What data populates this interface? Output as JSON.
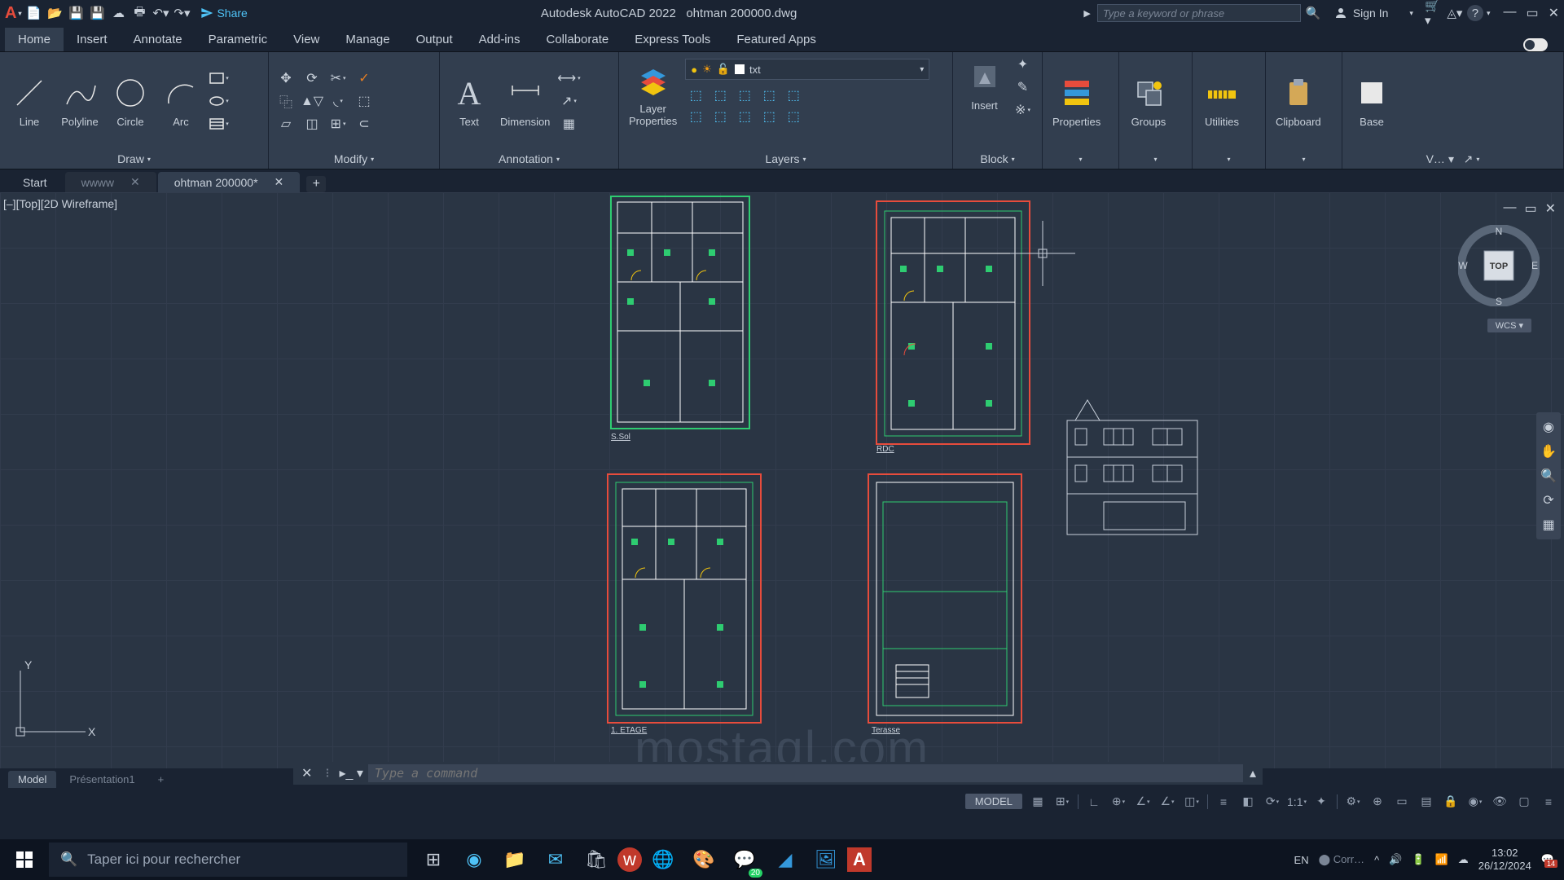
{
  "app": {
    "product": "Autodesk AutoCAD 2022",
    "filename": "ohtman 200000.dwg",
    "share_label": "Share",
    "search_placeholder": "Type a keyword or phrase",
    "signin_label": "Sign In"
  },
  "ribbon_tabs": [
    "Home",
    "Insert",
    "Annotate",
    "Parametric",
    "View",
    "Manage",
    "Output",
    "Add-ins",
    "Collaborate",
    "Express Tools",
    "Featured Apps"
  ],
  "panels": {
    "draw": {
      "label": "Draw",
      "tools": {
        "line": "Line",
        "polyline": "Polyline",
        "circle": "Circle",
        "arc": "Arc"
      }
    },
    "modify": {
      "label": "Modify"
    },
    "annotation": {
      "label": "Annotation",
      "text": "Text",
      "dimension": "Dimension"
    },
    "layers": {
      "label": "Layers",
      "properties": "Layer\nProperties",
      "current": "txt"
    },
    "block": {
      "label": "Block",
      "insert": "Insert"
    },
    "properties": {
      "label": "Properties"
    },
    "groups": {
      "label": "Groups"
    },
    "utilities": {
      "label": "Utilities"
    },
    "clipboard": {
      "label": "Clipboard"
    },
    "view": {
      "label": "V…",
      "base": "Base"
    }
  },
  "file_tabs": {
    "start": "Start",
    "t1": "wwww",
    "t2": "ohtman 200000*"
  },
  "viewport": {
    "label": "[–][Top][2D Wireframe]",
    "viewcube_face": "TOP",
    "compass": {
      "n": "N",
      "e": "E",
      "s": "S",
      "w": "W"
    },
    "wcs": "WCS",
    "plans": {
      "ssol": "S.Sol",
      "rdc": "RDC",
      "etage": "1. ETAGE",
      "terasse": "Terasse"
    },
    "ucs": {
      "x": "X",
      "y": "Y"
    }
  },
  "command_line": {
    "placeholder": "Type a command"
  },
  "model_tabs": {
    "model": "Model",
    "layout1": "Présentation1"
  },
  "statusbar": {
    "model": "MODEL",
    "scale": "1:1"
  },
  "taskbar": {
    "search_placeholder": "Taper ici pour rechercher",
    "lang": "EN",
    "app_hidden": "Corr…",
    "time": "13:02",
    "date": "26/12/2024",
    "notif_count": "14",
    "whatsapp_badge": "20"
  },
  "watermark": "mostaql.com"
}
